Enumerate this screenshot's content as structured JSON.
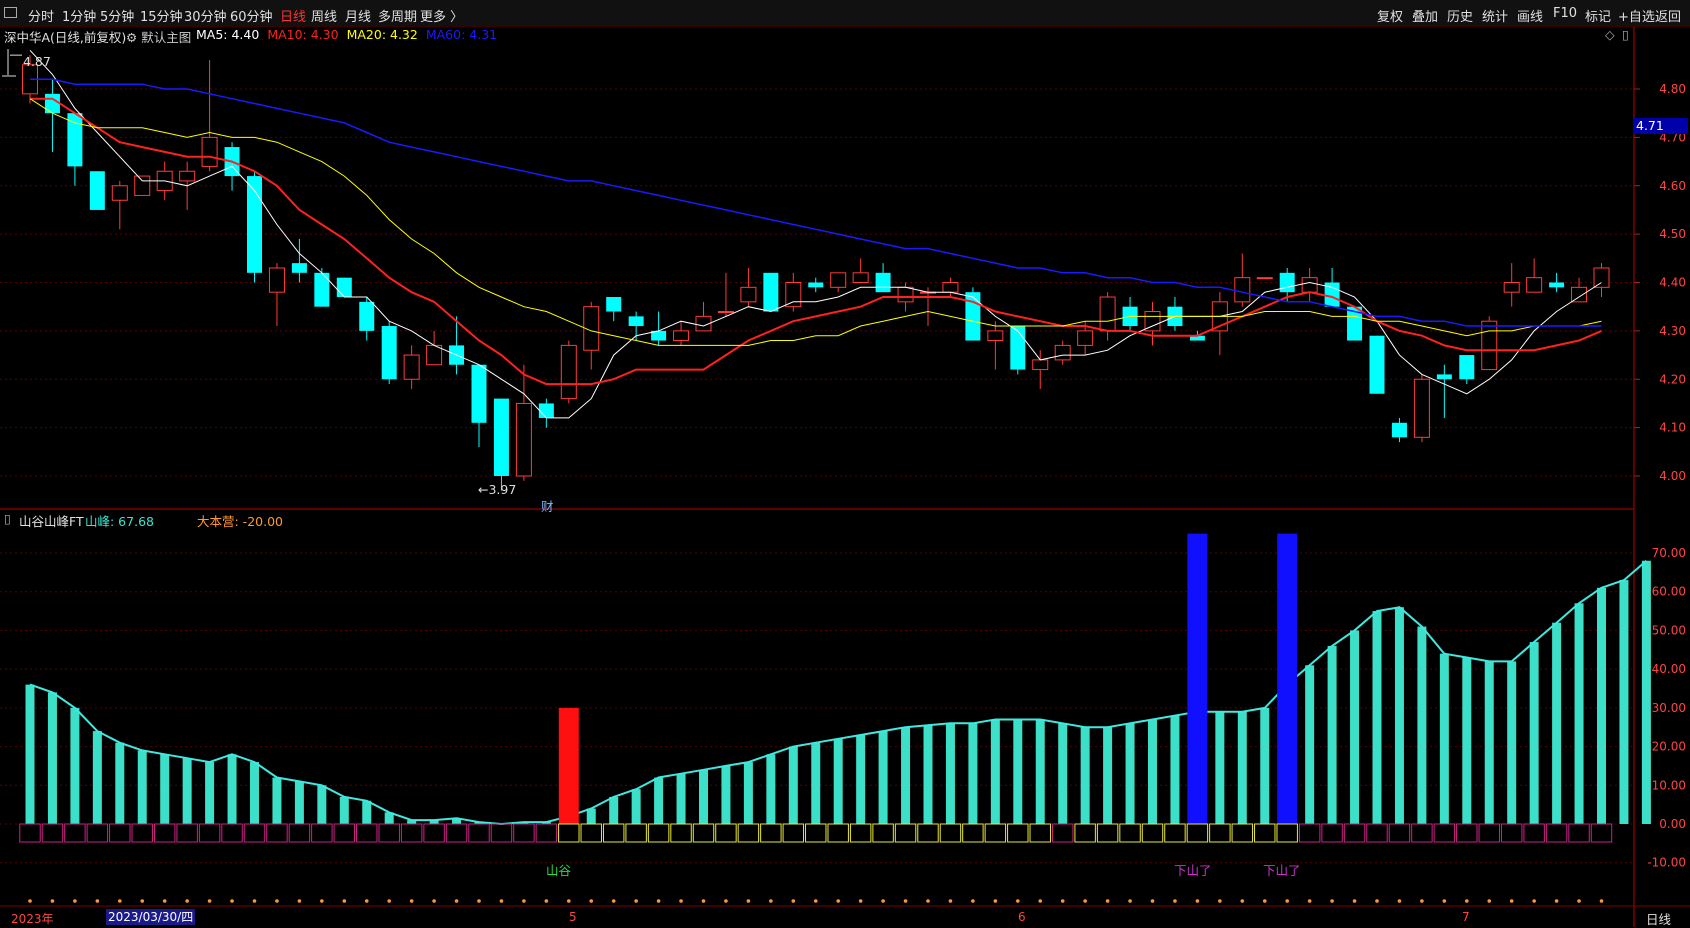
{
  "toolbar": {
    "left": [
      "分时",
      "1分钟",
      "5分钟",
      "15分钟",
      "30分钟",
      "60分钟",
      "日线",
      "周线",
      "月线",
      "多周期",
      "更多 〉"
    ],
    "active": "日线",
    "right": [
      "复权",
      "叠加",
      "历史",
      "统计",
      "画线",
      "F10",
      "标记",
      "+自选",
      "返回"
    ]
  },
  "main": {
    "title": "深中华A(日线,前复权)",
    "template": "默认主图",
    "ma": [
      {
        "label": "MA5: 4.40",
        "color": "#ffffff"
      },
      {
        "label": "MA10: 4.30",
        "color": "#ff2020"
      },
      {
        "label": "MA20: 4.32",
        "color": "#ffff00"
      },
      {
        "label": "MA60: 4.31",
        "color": "#1a1aff"
      }
    ],
    "high_label": "4.87",
    "low_label": "←3.97",
    "fin_marker": "财",
    "current_price": "4.71"
  },
  "indicator": {
    "name": "山谷山峰FT",
    "peak": "山峰: 67.68",
    "dabenying": "大本营: -20.00",
    "valley_label": "山谷",
    "down_label_1": "下山了",
    "down_label_2": "下山了"
  },
  "axis": {
    "dates": [
      "2023年",
      "2023/03/30/四",
      "5",
      "6",
      "7"
    ],
    "period": "日线"
  },
  "chart_data": [
    {
      "type": "candlestick",
      "title": "深中华A(日线,前复权)",
      "y_ticks": [
        4.8,
        4.7,
        4.6,
        4.5,
        4.4,
        4.3,
        4.2,
        4.1,
        4.0
      ],
      "ylim": [
        3.93,
        4.89
      ],
      "grid": true,
      "candles": [
        [
          4.79,
          4.85,
          4.87,
          4.77
        ],
        [
          4.79,
          4.75,
          4.82,
          4.67
        ],
        [
          4.75,
          4.64,
          4.75,
          4.6
        ],
        [
          4.63,
          4.55,
          4.63,
          4.55
        ],
        [
          4.57,
          4.6,
          4.61,
          4.51
        ],
        [
          4.58,
          4.62,
          4.62,
          4.58
        ],
        [
          4.59,
          4.63,
          4.65,
          4.57
        ],
        [
          4.61,
          4.63,
          4.65,
          4.55
        ],
        [
          4.64,
          4.7,
          4.86,
          4.63
        ],
        [
          4.68,
          4.62,
          4.69,
          4.59
        ],
        [
          4.62,
          4.42,
          4.63,
          4.4
        ],
        [
          4.38,
          4.43,
          4.44,
          4.31
        ],
        [
          4.44,
          4.42,
          4.49,
          4.4
        ],
        [
          4.42,
          4.35,
          4.43,
          4.35
        ],
        [
          4.41,
          4.37,
          4.41,
          4.37
        ],
        [
          4.36,
          4.3,
          4.37,
          4.28
        ],
        [
          4.31,
          4.2,
          4.32,
          4.19
        ],
        [
          4.2,
          4.25,
          4.27,
          4.18
        ],
        [
          4.23,
          4.27,
          4.3,
          4.23
        ],
        [
          4.27,
          4.23,
          4.33,
          4.21
        ],
        [
          4.23,
          4.11,
          4.23,
          4.06
        ],
        [
          4.16,
          4.0,
          4.16,
          3.97
        ],
        [
          4.0,
          4.15,
          4.23,
          3.99
        ],
        [
          4.15,
          4.12,
          4.16,
          4.1
        ],
        [
          4.16,
          4.27,
          4.28,
          4.15
        ],
        [
          4.26,
          4.35,
          4.36,
          4.22
        ],
        [
          4.37,
          4.34,
          4.37,
          4.32
        ],
        [
          4.33,
          4.31,
          4.34,
          4.28
        ],
        [
          4.3,
          4.28,
          4.34,
          4.27
        ],
        [
          4.28,
          4.3,
          4.32,
          4.27
        ],
        [
          4.3,
          4.33,
          4.36,
          4.3
        ],
        [
          4.34,
          4.34,
          4.42,
          4.33
        ],
        [
          4.36,
          4.39,
          4.43,
          4.35
        ],
        [
          4.42,
          4.34,
          4.42,
          4.34
        ],
        [
          4.35,
          4.4,
          4.42,
          4.34
        ],
        [
          4.4,
          4.39,
          4.41,
          4.38
        ],
        [
          4.39,
          4.42,
          4.42,
          4.38
        ],
        [
          4.4,
          4.42,
          4.45,
          4.4
        ],
        [
          4.42,
          4.38,
          4.44,
          4.38
        ],
        [
          4.36,
          4.39,
          4.4,
          4.34
        ],
        [
          4.38,
          4.38,
          4.39,
          4.31
        ],
        [
          4.38,
          4.4,
          4.41,
          4.37
        ],
        [
          4.38,
          4.28,
          4.39,
          4.28
        ],
        [
          4.28,
          4.3,
          4.32,
          4.22
        ],
        [
          4.31,
          4.22,
          4.31,
          4.21
        ],
        [
          4.22,
          4.24,
          4.26,
          4.18
        ],
        [
          4.24,
          4.27,
          4.28,
          4.23
        ],
        [
          4.27,
          4.3,
          4.32,
          4.25
        ],
        [
          4.3,
          4.37,
          4.38,
          4.28
        ],
        [
          4.35,
          4.31,
          4.37,
          4.3
        ],
        [
          4.3,
          4.34,
          4.36,
          4.27
        ],
        [
          4.35,
          4.31,
          4.37,
          4.3
        ],
        [
          4.29,
          4.28,
          4.3,
          4.28
        ],
        [
          4.3,
          4.36,
          4.38,
          4.25
        ],
        [
          4.36,
          4.41,
          4.46,
          4.35
        ],
        [
          4.41,
          4.41,
          4.41,
          4.41
        ],
        [
          4.42,
          4.38,
          4.43,
          4.36
        ],
        [
          4.38,
          4.41,
          4.43,
          4.36
        ],
        [
          4.4,
          4.35,
          4.43,
          4.35
        ],
        [
          4.35,
          4.28,
          4.35,
          4.28
        ],
        [
          4.29,
          4.17,
          4.29,
          4.17
        ],
        [
          4.11,
          4.08,
          4.12,
          4.07
        ],
        [
          4.08,
          4.2,
          4.21,
          4.07
        ],
        [
          4.21,
          4.2,
          4.23,
          4.12
        ],
        [
          4.25,
          4.2,
          4.25,
          4.19
        ],
        [
          4.22,
          4.32,
          4.33,
          4.22
        ],
        [
          4.38,
          4.4,
          4.44,
          4.35
        ],
        [
          4.38,
          4.41,
          4.45,
          4.38
        ],
        [
          4.4,
          4.39,
          4.42,
          4.38
        ],
        [
          4.36,
          4.39,
          4.41,
          4.36
        ],
        [
          4.39,
          4.43,
          4.44,
          4.37
        ]
      ],
      "series": [
        {
          "name": "MA5",
          "values": [
            4.88,
            4.83,
            4.76,
            4.71,
            4.66,
            4.61,
            4.61,
            4.6,
            4.62,
            4.64,
            4.59,
            4.52,
            4.46,
            4.42,
            4.37,
            4.37,
            4.32,
            4.3,
            4.27,
            4.25,
            4.23,
            4.2,
            4.17,
            4.12,
            4.12,
            4.16,
            4.25,
            4.29,
            4.3,
            4.32,
            4.31,
            4.33,
            4.35,
            4.34,
            4.36,
            4.36,
            4.37,
            4.39,
            4.39,
            4.39,
            4.38,
            4.38,
            4.37,
            4.33,
            4.3,
            4.24,
            4.25,
            4.25,
            4.26,
            4.29,
            4.31,
            4.33,
            4.33,
            4.33,
            4.34,
            4.38,
            4.39,
            4.4,
            4.39,
            4.37,
            4.32,
            4.25,
            4.21,
            4.19,
            4.17,
            4.2,
            4.24,
            4.3,
            4.34,
            4.37,
            4.4
          ]
        },
        {
          "name": "MA10",
          "values": [
            4.78,
            4.78,
            4.75,
            4.72,
            4.69,
            4.68,
            4.67,
            4.66,
            4.66,
            4.65,
            4.63,
            4.6,
            4.55,
            4.52,
            4.49,
            4.45,
            4.41,
            4.38,
            4.36,
            4.32,
            4.28,
            4.25,
            4.21,
            4.19,
            4.19,
            4.19,
            4.2,
            4.22,
            4.22,
            4.22,
            4.22,
            4.25,
            4.28,
            4.3,
            4.32,
            4.33,
            4.34,
            4.35,
            4.37,
            4.37,
            4.37,
            4.37,
            4.36,
            4.34,
            4.33,
            4.32,
            4.31,
            4.31,
            4.3,
            4.3,
            4.29,
            4.29,
            4.29,
            4.31,
            4.33,
            4.35,
            4.37,
            4.38,
            4.37,
            4.35,
            4.32,
            4.3,
            4.29,
            4.27,
            4.26,
            4.26,
            4.26,
            4.26,
            4.27,
            4.28,
            4.3
          ]
        },
        {
          "name": "MA20",
          "values": [
            4.78,
            4.75,
            4.73,
            4.72,
            4.72,
            4.72,
            4.71,
            4.7,
            4.71,
            4.7,
            4.7,
            4.69,
            4.67,
            4.65,
            4.62,
            4.58,
            4.53,
            4.49,
            4.46,
            4.42,
            4.39,
            4.37,
            4.35,
            4.34,
            4.32,
            4.3,
            4.29,
            4.28,
            4.27,
            4.27,
            4.27,
            4.27,
            4.27,
            4.28,
            4.28,
            4.29,
            4.29,
            4.31,
            4.32,
            4.33,
            4.34,
            4.33,
            4.32,
            4.31,
            4.31,
            4.31,
            4.31,
            4.32,
            4.32,
            4.33,
            4.33,
            4.33,
            4.33,
            4.33,
            4.33,
            4.34,
            4.34,
            4.34,
            4.33,
            4.33,
            4.32,
            4.32,
            4.31,
            4.3,
            4.29,
            4.3,
            4.3,
            4.31,
            4.31,
            4.31,
            4.32
          ]
        },
        {
          "name": "MA60",
          "values": [
            4.82,
            4.82,
            4.81,
            4.81,
            4.81,
            4.81,
            4.8,
            4.8,
            4.79,
            4.78,
            4.77,
            4.76,
            4.75,
            4.74,
            4.73,
            4.71,
            4.69,
            4.68,
            4.67,
            4.66,
            4.65,
            4.64,
            4.63,
            4.62,
            4.61,
            4.61,
            4.6,
            4.59,
            4.58,
            4.57,
            4.56,
            4.55,
            4.54,
            4.53,
            4.52,
            4.51,
            4.5,
            4.49,
            4.48,
            4.47,
            4.47,
            4.46,
            4.45,
            4.44,
            4.43,
            4.43,
            4.42,
            4.42,
            4.41,
            4.41,
            4.4,
            4.4,
            4.39,
            4.39,
            4.38,
            4.37,
            4.36,
            4.36,
            4.35,
            4.34,
            4.33,
            4.33,
            4.32,
            4.32,
            4.31,
            4.31,
            4.31,
            4.31,
            4.31,
            4.31,
            4.31
          ]
        }
      ]
    },
    {
      "type": "bar",
      "title": "山谷山峰FT",
      "y_ticks": [
        70.0,
        60.0,
        50.0,
        40.0,
        30.0,
        20.0,
        10.0,
        0.0,
        -10.0
      ],
      "ylim": [
        -20,
        78
      ],
      "grid": true,
      "series": [
        {
          "name": "山峰",
          "values": [
            36,
            34,
            30,
            24,
            21,
            19,
            18,
            17,
            16,
            18,
            16,
            12,
            11,
            10,
            7,
            6,
            3,
            1,
            1,
            1.5,
            0.5,
            0,
            0.5,
            0.5,
            2,
            4,
            7,
            9,
            12,
            13,
            14,
            15,
            16,
            18,
            20,
            21,
            22,
            23,
            24,
            25,
            25.5,
            26,
            26,
            27,
            27,
            27,
            26,
            25,
            25,
            26,
            27,
            28,
            29,
            29,
            29,
            30,
            36,
            41,
            46,
            50,
            55,
            56,
            51,
            44,
            43,
            42,
            42,
            47,
            52,
            57,
            61,
            63,
            68
          ]
        },
        {
          "name": "山谷",
          "values": [
            {
              "index": 24,
              "value": 30
            }
          ]
        },
        {
          "name": "下山了",
          "values": [
            {
              "index": 52,
              "value": 75
            },
            {
              "index": 56,
              "value": 75
            }
          ]
        }
      ]
    }
  ]
}
